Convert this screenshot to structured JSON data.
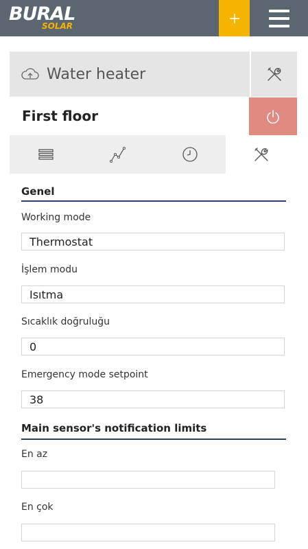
{
  "header": {
    "logo_main": "BURAL",
    "logo_sub": "SOLAR",
    "add_label": "+"
  },
  "device": {
    "name": "Water heater",
    "zone": "First floor"
  },
  "tabs": [
    {
      "icon": "list-icon"
    },
    {
      "icon": "chart-line-icon"
    },
    {
      "icon": "clock-icon"
    },
    {
      "icon": "tools-icon",
      "active": true
    }
  ],
  "sections": {
    "general": {
      "title": "Genel",
      "fields": {
        "working_mode": {
          "label": "Working mode",
          "value": "Thermostat"
        },
        "process_mode": {
          "label": "İşlem modu",
          "value": "Isıtma"
        },
        "temp_accuracy": {
          "label": "Sıcaklık doğruluğu",
          "value": "0"
        },
        "emergency_setpoint": {
          "label": "Emergency mode setpoint",
          "value": "38"
        }
      }
    },
    "limits": {
      "title": "Main sensor's notification limits",
      "fields": {
        "min": {
          "label": "En az",
          "value": ""
        },
        "max": {
          "label": "En çok",
          "value": ""
        }
      }
    }
  },
  "colors": {
    "topbar": "#5b6670",
    "accent": "#f5b400",
    "power": "#e18a82",
    "rule": "#2c3e63"
  }
}
